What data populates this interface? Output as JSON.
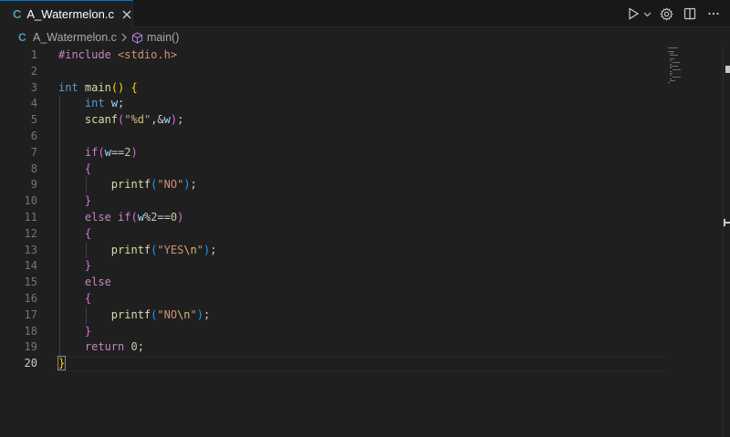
{
  "tab": {
    "icon_letter": "C",
    "filename": "A_Watermelon.c"
  },
  "breadcrumb": {
    "icon_letter": "C",
    "file": "A_Watermelon.c",
    "symbol": "main()"
  },
  "editor": {
    "active_line": 20,
    "line_numbers": [
      "1",
      "2",
      "3",
      "4",
      "5",
      "6",
      "7",
      "8",
      "9",
      "10",
      "11",
      "12",
      "13",
      "14",
      "15",
      "16",
      "17",
      "18",
      "19",
      "20"
    ],
    "lines": [
      [
        [
          "pre",
          "#include "
        ],
        [
          "hdr",
          "<stdio.h>"
        ]
      ],
      [],
      [
        [
          "kw",
          "int "
        ],
        [
          "fn",
          "main"
        ],
        [
          "b1",
          "()"
        ],
        [
          "plain",
          " "
        ],
        [
          "b1",
          "{"
        ]
      ],
      [
        [
          "plain",
          "    "
        ],
        [
          "kw",
          "int "
        ],
        [
          "var",
          "w"
        ],
        [
          "plain",
          ";"
        ]
      ],
      [
        [
          "plain",
          "    "
        ],
        [
          "fn",
          "scanf"
        ],
        [
          "b2",
          "("
        ],
        [
          "str",
          "\""
        ],
        [
          "esc",
          "%d"
        ],
        [
          "str",
          "\""
        ],
        [
          "plain",
          ","
        ],
        [
          "plain",
          "&"
        ],
        [
          "var",
          "w"
        ],
        [
          "b2",
          ")"
        ],
        [
          "plain",
          ";"
        ]
      ],
      [],
      [
        [
          "plain",
          "    "
        ],
        [
          "ctl",
          "if"
        ],
        [
          "b2",
          "("
        ],
        [
          "var",
          "w"
        ],
        [
          "plain",
          "=="
        ],
        [
          "num",
          "2"
        ],
        [
          "b2",
          ")"
        ]
      ],
      [
        [
          "plain",
          "    "
        ],
        [
          "b2",
          "{"
        ]
      ],
      [
        [
          "plain",
          "        "
        ],
        [
          "fn",
          "printf"
        ],
        [
          "b3",
          "("
        ],
        [
          "str",
          "\"NO\""
        ],
        [
          "b3",
          ")"
        ],
        [
          "plain",
          ";"
        ]
      ],
      [
        [
          "plain",
          "    "
        ],
        [
          "b2",
          "}"
        ]
      ],
      [
        [
          "plain",
          "    "
        ],
        [
          "ctl",
          "else if"
        ],
        [
          "b2",
          "("
        ],
        [
          "var",
          "w"
        ],
        [
          "plain",
          "%"
        ],
        [
          "num",
          "2"
        ],
        [
          "plain",
          "=="
        ],
        [
          "num",
          "0"
        ],
        [
          "b2",
          ")"
        ]
      ],
      [
        [
          "plain",
          "    "
        ],
        [
          "b2",
          "{"
        ]
      ],
      [
        [
          "plain",
          "        "
        ],
        [
          "fn",
          "printf"
        ],
        [
          "b3",
          "("
        ],
        [
          "str",
          "\"YES"
        ],
        [
          "esc",
          "\\n"
        ],
        [
          "str",
          "\""
        ],
        [
          "b3",
          ")"
        ],
        [
          "plain",
          ";"
        ]
      ],
      [
        [
          "plain",
          "    "
        ],
        [
          "b2",
          "}"
        ]
      ],
      [
        [
          "plain",
          "    "
        ],
        [
          "ctl",
          "else"
        ]
      ],
      [
        [
          "plain",
          "    "
        ],
        [
          "b2",
          "{"
        ]
      ],
      [
        [
          "plain",
          "        "
        ],
        [
          "fn",
          "printf"
        ],
        [
          "b3",
          "("
        ],
        [
          "str",
          "\"NO"
        ],
        [
          "esc",
          "\\n"
        ],
        [
          "str",
          "\""
        ],
        [
          "b3",
          ")"
        ],
        [
          "plain",
          ";"
        ]
      ],
      [
        [
          "plain",
          "    "
        ],
        [
          "b2",
          "}"
        ]
      ],
      [
        [
          "plain",
          "    "
        ],
        [
          "ctl",
          "return "
        ],
        [
          "num",
          "0"
        ],
        [
          "plain",
          ";"
        ]
      ],
      [
        [
          "b1",
          "}"
        ]
      ]
    ]
  },
  "colors": {
    "accent": "#0078d4",
    "c_icon": "#519aba"
  },
  "icons": {
    "close": "close-icon",
    "run": "play-icon",
    "run_dropdown": "chevron-down-icon",
    "settings": "gear-icon",
    "split": "split-editor-icon",
    "more": "ellipsis-icon",
    "breadcrumb_sep": "chevron-right-icon",
    "symbol": "cube-icon"
  }
}
